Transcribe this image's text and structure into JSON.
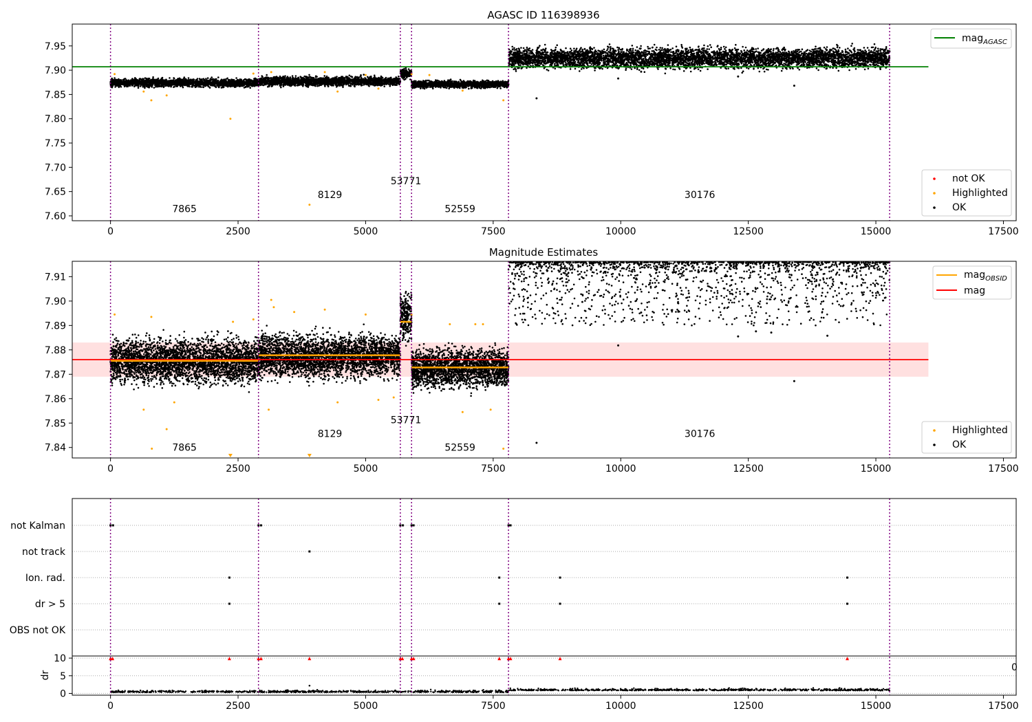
{
  "chart_data": [
    {
      "type": "scatter",
      "title": "AGASC ID 116398936",
      "xlim": [
        -750,
        17750
      ],
      "ylim": [
        7.59,
        7.995
      ],
      "xticks": [
        0,
        2500,
        5000,
        7500,
        10000,
        12500,
        15000,
        17500
      ],
      "xtick_labels": [
        "0",
        "2500",
        "5000",
        "7500",
        "10000",
        "12500",
        "15000",
        "17500"
      ],
      "yticks": [
        7.6,
        7.65,
        7.7,
        7.75,
        7.8,
        7.85,
        7.9,
        7.95
      ],
      "ytick_labels": [
        "7.60",
        "7.65",
        "7.70",
        "7.75",
        "7.80",
        "7.85",
        "7.90",
        "7.95"
      ],
      "obsid_boundaries": [
        0,
        2900,
        5680,
        5900,
        7800,
        15270
      ],
      "obsid_labels": [
        {
          "text": "7865",
          "x": 1450,
          "y": 7.608
        },
        {
          "text": "8129",
          "x": 4300,
          "y": 7.637
        },
        {
          "text": "53771",
          "x": 5790,
          "y": 7.665
        },
        {
          "text": "52559",
          "x": 6850,
          "y": 7.608
        },
        {
          "text": "30176",
          "x": 11550,
          "y": 7.637
        }
      ],
      "series": [
        {
          "name": "not OK",
          "color": "#ff0000",
          "points": []
        },
        {
          "name": "Highlighted",
          "color": "#ffa500",
          "points": [
            [
              80,
              7.892
            ],
            [
              800,
              7.838
            ],
            [
              1100,
              7.848
            ],
            [
              2350,
              7.8
            ],
            [
              2800,
              7.893
            ],
            [
              3150,
              7.896
            ],
            [
              3900,
              7.623
            ],
            [
              4200,
              7.896
            ],
            [
              5000,
              7.89
            ],
            [
              5250,
              7.862
            ],
            [
              5900,
              7.892
            ],
            [
              6900,
              7.858
            ],
            [
              7700,
              7.838
            ],
            [
              650,
              7.856
            ],
            [
              4450,
              7.856
            ],
            [
              6250,
              7.89
            ]
          ]
        },
        {
          "name": "OK",
          "color": "#000000",
          "bands": [
            {
              "x0": 0,
              "x1": 2900,
              "center": 7.874,
              "spread": 0.008
            },
            {
              "x0": 2900,
              "x1": 5680,
              "center": 7.877,
              "spread": 0.009
            },
            {
              "x0": 5680,
              "x1": 5900,
              "center": 7.893,
              "spread": 0.01
            },
            {
              "x0": 5900,
              "x1": 7800,
              "center": 7.871,
              "spread": 0.007
            },
            {
              "x0": 7800,
              "x1": 15270,
              "center": 7.925,
              "spread": 0.02
            }
          ],
          "outliers": [
            [
              8350,
              7.842
            ],
            [
              9950,
              7.883
            ],
            [
              13400,
              7.868
            ],
            [
              10400,
              7.897
            ],
            [
              12300,
              7.887
            ]
          ]
        }
      ],
      "mag_agasc": 7.907,
      "legend": [
        {
          "label": "mag",
          "sub": "AGASC",
          "color": "#008000",
          "kind": "line"
        }
      ],
      "legend2": [
        "not OK",
        "Highlighted",
        "OK"
      ]
    },
    {
      "type": "scatter",
      "title": "Magnitude Estimates",
      "xlim": [
        -750,
        17750
      ],
      "ylim": [
        7.8357,
        7.9163
      ],
      "xticks": [
        0,
        2500,
        5000,
        7500,
        10000,
        12500,
        15000,
        17500
      ],
      "xtick_labels": [
        "0",
        "2500",
        "5000",
        "7500",
        "10000",
        "12500",
        "15000",
        "17500"
      ],
      "yticks": [
        7.84,
        7.85,
        7.86,
        7.87,
        7.88,
        7.89,
        7.9,
        7.91
      ],
      "ytick_labels": [
        "7.84",
        "7.85",
        "7.86",
        "7.87",
        "7.88",
        "7.89",
        "7.90",
        "7.91"
      ],
      "obsid_boundaries": [
        0,
        2900,
        5680,
        5900,
        7800,
        15270
      ],
      "obsid_labels": [
        {
          "text": "7865",
          "x": 1450,
          "y": 7.8387
        },
        {
          "text": "8129",
          "x": 4300,
          "y": 7.8443
        },
        {
          "text": "53771",
          "x": 5790,
          "y": 7.8499
        },
        {
          "text": "52559",
          "x": 6850,
          "y": 7.8387
        },
        {
          "text": "30176",
          "x": 11550,
          "y": 7.8443
        }
      ],
      "mag": 7.876,
      "mag_band": [
        7.869,
        7.883
      ],
      "mag_obsid": [
        {
          "x0": 0,
          "x1": 2900,
          "y": 7.8755
        },
        {
          "x0": 2900,
          "x1": 5680,
          "y": 7.8778
        },
        {
          "x0": 5680,
          "x1": 5900,
          "y": 7.8915
        },
        {
          "x0": 5900,
          "x1": 7800,
          "y": 7.8728
        }
      ],
      "highlighted": [
        [
          80,
          7.8945
        ],
        [
          800,
          7.8935
        ],
        [
          1100,
          7.8475
        ],
        [
          1250,
          7.8585
        ],
        [
          2400,
          7.8915
        ],
        [
          2800,
          7.8925
        ],
        [
          3150,
          7.9005
        ],
        [
          3200,
          7.8975
        ],
        [
          3100,
          7.8555
        ],
        [
          3600,
          7.8955
        ],
        [
          4200,
          7.8965
        ],
        [
          4450,
          7.8585
        ],
        [
          5000,
          7.8945
        ],
        [
          5250,
          7.8595
        ],
        [
          5550,
          7.8605
        ],
        [
          5900,
          7.8945
        ],
        [
          6650,
          7.8905
        ],
        [
          6900,
          7.8545
        ],
        [
          7150,
          7.8905
        ],
        [
          7300,
          7.8905
        ],
        [
          7450,
          7.8555
        ],
        [
          7700,
          7.8395
        ],
        [
          650,
          7.8555
        ],
        [
          810,
          7.8395
        ]
      ],
      "highlighted_offscale": [
        2350,
        3900
      ],
      "ok_bands": [
        {
          "x0": 0,
          "x1": 2900,
          "center": 7.8755,
          "spread": 0.0085
        },
        {
          "x0": 2900,
          "x1": 5680,
          "center": 7.8775,
          "spread": 0.0085
        },
        {
          "x0": 5680,
          "x1": 5900,
          "center": 7.8935,
          "spread": 0.009
        },
        {
          "x0": 5900,
          "x1": 7800,
          "center": 7.8725,
          "spread": 0.0075
        }
      ],
      "ok_top": {
        "x0": 7800,
        "x1": 15270,
        "ymin": 7.89,
        "ymax": 7.916
      },
      "ok_outliers": [
        [
          8350,
          7.8419
        ],
        [
          9950,
          7.8818
        ],
        [
          13400,
          7.8672
        ],
        [
          10400,
          7.8953
        ],
        [
          12300,
          7.8855
        ],
        [
          12650,
          7.8876
        ],
        [
          12950,
          7.8871
        ],
        [
          14050,
          7.8858
        ]
      ],
      "legend": [
        {
          "label": "mag",
          "sub": "OBSID",
          "color": "#ffa500",
          "kind": "line"
        },
        {
          "label": "mag",
          "sub": "",
          "color": "#ff0000",
          "kind": "line"
        }
      ],
      "legend2": [
        "Highlighted",
        "OK"
      ]
    },
    {
      "type": "flags",
      "xlim": [
        -750,
        17750
      ],
      "categories": [
        "not Kalman",
        "not track",
        "Ion. rad.",
        "dr > 5",
        "OBS not OK"
      ],
      "obsid_boundaries": [
        0,
        2900,
        5680,
        5900,
        7800,
        15270
      ],
      "flag_points": {
        "not Kalman": [
          0,
          50,
          2900,
          2950,
          5680,
          5730,
          5900,
          5940,
          7800,
          7840
        ],
        "not track": [
          3900
        ],
        "Ion. rad.": [
          2330,
          7620,
          8810,
          14440
        ],
        "dr > 5": [
          2330,
          7620,
          8810,
          14440
        ],
        "OBS not OK": []
      },
      "dr": {
        "ylabel": "dr",
        "yticks": [
          0,
          5,
          10
        ],
        "ytick_labels": [
          "0",
          "5",
          "10"
        ],
        "ylim": [
          -0.5,
          10.6
        ],
        "high_markers": [
          0,
          40,
          2900,
          2950,
          5680,
          5720,
          5900,
          5940,
          7800,
          7840,
          2330,
          3900,
          7620,
          8810,
          14440
        ],
        "high_value": 9.8,
        "mid_points": [
          [
            3900,
            2.2
          ]
        ],
        "base_level": 0.3,
        "base_level_late": 0.8
      },
      "xticks": [
        0,
        2500,
        5000,
        7500,
        10000,
        12500,
        15000,
        17500
      ],
      "xtick_labels": [
        "0",
        "2500",
        "5000",
        "7500",
        "10000",
        "12500",
        "15000",
        "17500"
      ],
      "clipped_text": "0"
    }
  ]
}
